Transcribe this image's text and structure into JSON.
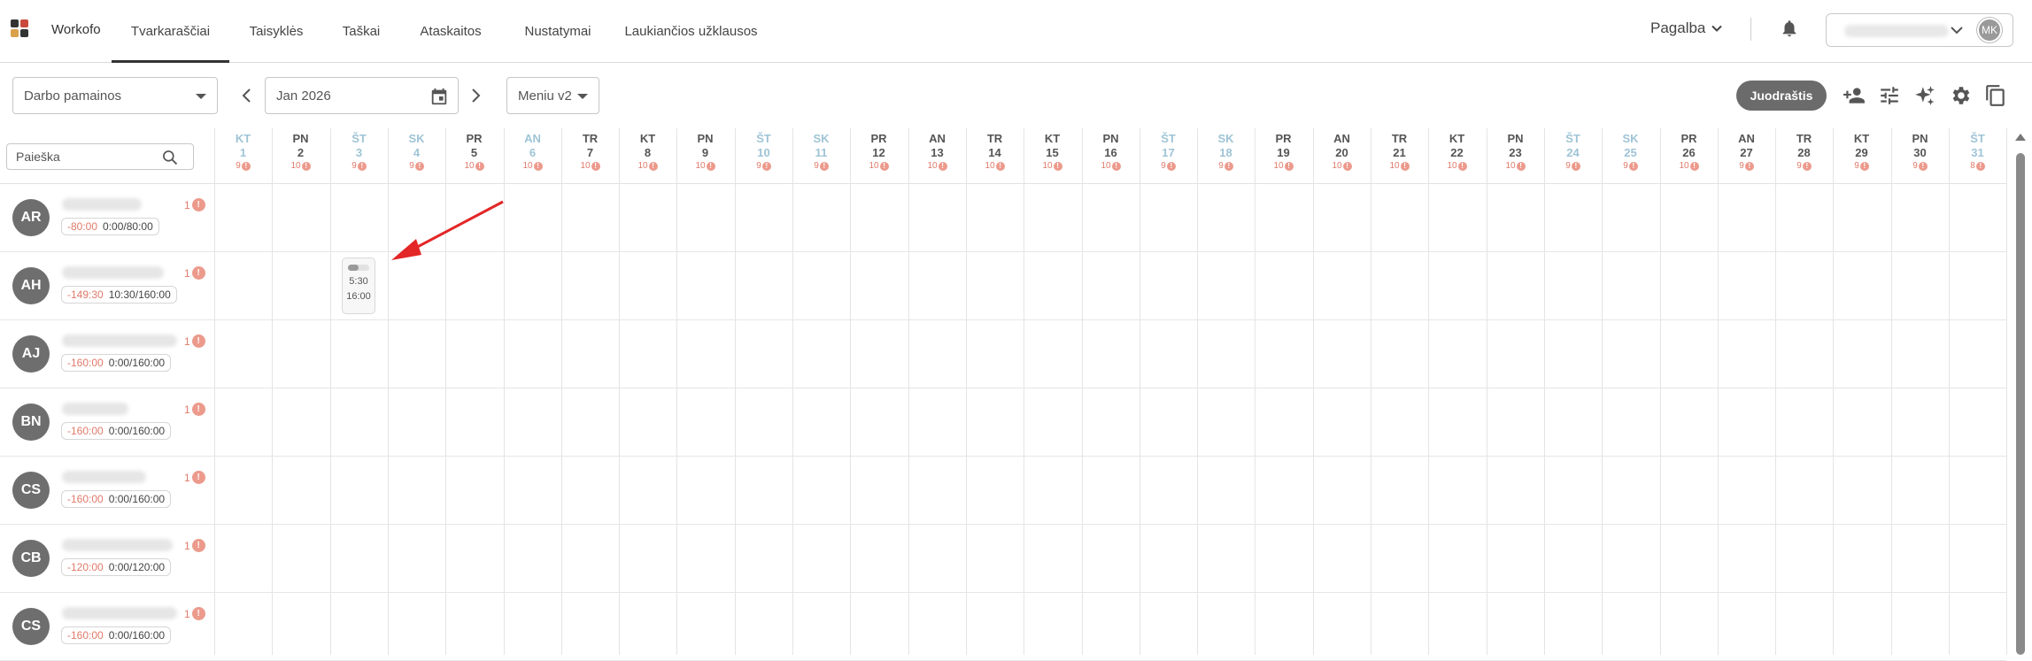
{
  "app": {
    "name": "Workofo"
  },
  "nav": {
    "tabs": [
      {
        "label": "Tvarkaraščiai",
        "active": true
      },
      {
        "label": "Taisyklės"
      },
      {
        "label": "Taškai"
      },
      {
        "label": "Ataskaitos"
      },
      {
        "label": "Nustatymai"
      },
      {
        "label": "Laukiančios užklausos"
      }
    ],
    "help_label": "Pagalba",
    "user_initials": "MK"
  },
  "toolbar": {
    "view_select": "Darbo pamainos",
    "date": "Jan 2026",
    "menu_select": "Meniu v2",
    "juodrastis_label": "Juodraštis",
    "icons": [
      "add-person-icon",
      "sliders-icon",
      "sparkle-icon",
      "gear-icon",
      "copy-icon"
    ]
  },
  "search": {
    "placeholder": "Paieška"
  },
  "days": [
    {
      "name": "KT",
      "num": "1",
      "count": "9",
      "weekend": true
    },
    {
      "name": "PN",
      "num": "2",
      "count": "10"
    },
    {
      "name": "ŠT",
      "num": "3",
      "count": "9",
      "weekend": true
    },
    {
      "name": "SK",
      "num": "4",
      "count": "9",
      "weekend": true
    },
    {
      "name": "PR",
      "num": "5",
      "count": "10"
    },
    {
      "name": "AN",
      "num": "6",
      "count": "10",
      "weekend": true
    },
    {
      "name": "TR",
      "num": "7",
      "count": "10"
    },
    {
      "name": "KT",
      "num": "8",
      "count": "10"
    },
    {
      "name": "PN",
      "num": "9",
      "count": "10"
    },
    {
      "name": "ŠT",
      "num": "10",
      "count": "9",
      "weekend": true
    },
    {
      "name": "SK",
      "num": "11",
      "count": "9",
      "weekend": true
    },
    {
      "name": "PR",
      "num": "12",
      "count": "10"
    },
    {
      "name": "AN",
      "num": "13",
      "count": "10"
    },
    {
      "name": "TR",
      "num": "14",
      "count": "10"
    },
    {
      "name": "KT",
      "num": "15",
      "count": "10"
    },
    {
      "name": "PN",
      "num": "16",
      "count": "10"
    },
    {
      "name": "ŠT",
      "num": "17",
      "count": "9",
      "weekend": true
    },
    {
      "name": "SK",
      "num": "18",
      "count": "9",
      "weekend": true
    },
    {
      "name": "PR",
      "num": "19",
      "count": "10"
    },
    {
      "name": "AN",
      "num": "20",
      "count": "10"
    },
    {
      "name": "TR",
      "num": "21",
      "count": "10"
    },
    {
      "name": "KT",
      "num": "22",
      "count": "10"
    },
    {
      "name": "PN",
      "num": "23",
      "count": "10"
    },
    {
      "name": "ŠT",
      "num": "24",
      "count": "9",
      "weekend": true
    },
    {
      "name": "SK",
      "num": "25",
      "count": "9",
      "weekend": true
    },
    {
      "name": "PR",
      "num": "26",
      "count": "10"
    },
    {
      "name": "AN",
      "num": "27",
      "count": "9"
    },
    {
      "name": "TR",
      "num": "28",
      "count": "9"
    },
    {
      "name": "KT",
      "num": "29",
      "count": "9"
    },
    {
      "name": "PN",
      "num": "30",
      "count": "9"
    },
    {
      "name": "ŠT",
      "num": "31",
      "count": "8",
      "weekend": true
    }
  ],
  "employees": [
    {
      "initials": "AR",
      "badge": "1",
      "deficit": "-80:00",
      "hours": "0:00/80:00"
    },
    {
      "initials": "AH",
      "badge": "1",
      "deficit": "-149:30",
      "hours": "10:30/160:00"
    },
    {
      "initials": "AJ",
      "badge": "1",
      "deficit": "-160:00",
      "hours": "0:00/160:00"
    },
    {
      "initials": "BN",
      "badge": "1",
      "deficit": "-160:00",
      "hours": "0:00/160:00"
    },
    {
      "initials": "CS",
      "badge": "1",
      "deficit": "-160:00",
      "hours": "0:00/160:00"
    },
    {
      "initials": "CB",
      "badge": "1",
      "deficit": "-120:00",
      "hours": "0:00/120:00"
    },
    {
      "initials": "CS",
      "badge": "1",
      "deficit": "-160:00",
      "hours": "0:00/160:00"
    }
  ],
  "shift": {
    "start": "5:30",
    "end": "16:00"
  },
  "colors": {
    "accent_warn": "#e07a6a",
    "weekend": "#9fc4d6",
    "annotation": "#e32626"
  }
}
